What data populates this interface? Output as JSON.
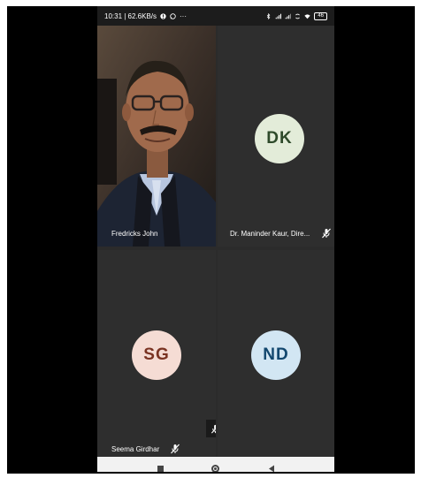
{
  "status_bar": {
    "time_and_speed": "10:31 | 62.6KB/s",
    "more_indicator": "···",
    "battery": "46"
  },
  "participants": [
    {
      "name": "Fredricks John",
      "kind": "video"
    },
    {
      "initials": "DK",
      "name": "Dr. Maninder Kaur, Dire...",
      "muted": true
    },
    {
      "initials": "SG",
      "name": "Seema Girdhar",
      "muted": true
    },
    {
      "initials": "ND",
      "name": ""
    }
  ],
  "colors": {
    "tile_background": "#2e2e2e",
    "avatar_dk": "#e3ecd9",
    "avatar_sg": "#f5dcd4",
    "avatar_nd": "#d2e6f3"
  },
  "navigation_bar": {
    "buttons": [
      "recents-icon",
      "home-icon",
      "back-icon"
    ]
  }
}
